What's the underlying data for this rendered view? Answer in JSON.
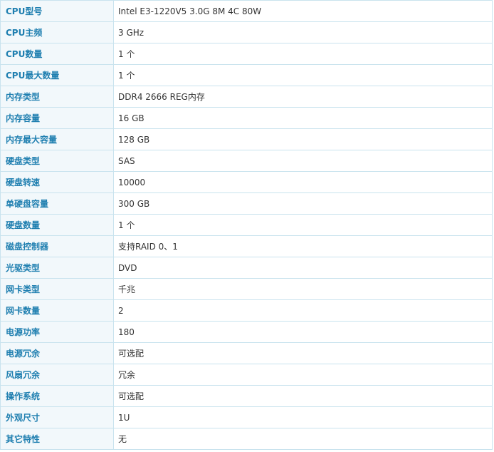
{
  "specs": [
    {
      "label": "CPU型号",
      "value": "Intel E3-1220V5 3.0G 8M 4C 80W"
    },
    {
      "label": "CPU主频",
      "value": "3  GHz"
    },
    {
      "label": "CPU数量",
      "value": "1  个"
    },
    {
      "label": "CPU最大数量",
      "value": "1  个"
    },
    {
      "label": "内存类型",
      "value": "DDR4 2666 REG内存"
    },
    {
      "label": "内存容量",
      "value": "16  GB"
    },
    {
      "label": "内存最大容量",
      "value": "128  GB"
    },
    {
      "label": "硬盘类型",
      "value": "SAS"
    },
    {
      "label": "硬盘转速",
      "value": "10000"
    },
    {
      "label": "单硬盘容量",
      "value": "300  GB"
    },
    {
      "label": "硬盘数量",
      "value": "1  个"
    },
    {
      "label": "磁盘控制器",
      "value": "支持RAID 0、1"
    },
    {
      "label": "光驱类型",
      "value": "DVD"
    },
    {
      "label": "网卡类型",
      "value": "千兆"
    },
    {
      "label": "网卡数量",
      "value": "2"
    },
    {
      "label": "电源功率",
      "value": "180"
    },
    {
      "label": "电源冗余",
      "value": "可选配"
    },
    {
      "label": "风扇冗余",
      "value": "冗余"
    },
    {
      "label": "操作系统",
      "value": "可选配"
    },
    {
      "label": "外观尺寸",
      "value": "1U"
    },
    {
      "label": "其它特性",
      "value": "无"
    }
  ]
}
